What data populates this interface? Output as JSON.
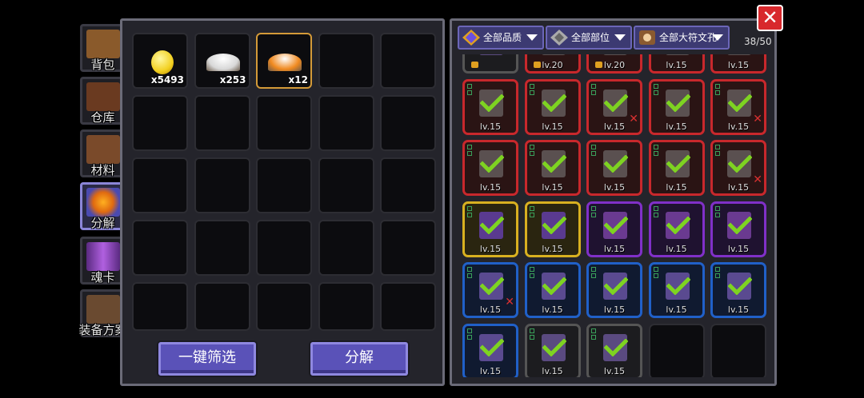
{
  "side_tabs": [
    {
      "label": "背包",
      "icon": "backpack-icon",
      "color": "#8a5a2b"
    },
    {
      "label": "仓库",
      "icon": "warehouse-chest-icon",
      "color": "#6a3a20"
    },
    {
      "label": "材料",
      "icon": "materials-book-icon",
      "color": "#7a4a2a"
    },
    {
      "label": "分解",
      "icon": "decompose-furnace-icon",
      "color": "#e06a10"
    },
    {
      "label": "魂卡",
      "icon": "soul-card-icon",
      "color": "#7a3aa0"
    },
    {
      "label": "装备方案",
      "icon": "equipment-plan-icon",
      "color": "#6a4a30"
    }
  ],
  "materials": [
    {
      "name": "gold-coin",
      "qty": "x5493",
      "color": "#f2d020"
    },
    {
      "name": "white-powder",
      "qty": "x253",
      "color": "#d8d8d8"
    },
    {
      "name": "orange-powder",
      "qty": "x12",
      "color": "#f08a20"
    }
  ],
  "left_buttons": {
    "quick_filter": "一键筛选",
    "decompose": "分解"
  },
  "filters": {
    "quality": "全部品质",
    "slot": "全部部位",
    "rune": "全部大符文孔"
  },
  "capacity": "38/50",
  "equipment": [
    {
      "q": "gray",
      "lvl": "",
      "lock": true
    },
    {
      "q": "red",
      "lvl": "lv.20",
      "lock": true
    },
    {
      "q": "red",
      "lvl": "lv.20",
      "lock": true
    },
    {
      "q": "red",
      "lvl": "lv.15",
      "lock": false
    },
    {
      "q": "red",
      "lvl": "lv.15",
      "lock": false
    },
    {
      "q": "red",
      "lvl": "lv.15",
      "check": true,
      "x": false
    },
    {
      "q": "red",
      "lvl": "lv.15",
      "check": true,
      "x": false
    },
    {
      "q": "red",
      "lvl": "lv.15",
      "check": true,
      "x": true
    },
    {
      "q": "red",
      "lvl": "lv.15",
      "check": true,
      "x": false
    },
    {
      "q": "red",
      "lvl": "lv.15",
      "check": true,
      "x": true
    },
    {
      "q": "red",
      "lvl": "lv.15",
      "check": true,
      "x": false
    },
    {
      "q": "red",
      "lvl": "lv.15",
      "check": true,
      "x": false
    },
    {
      "q": "red",
      "lvl": "lv.15",
      "check": true,
      "x": false
    },
    {
      "q": "red",
      "lvl": "lv.15",
      "check": true,
      "x": false
    },
    {
      "q": "red",
      "lvl": "lv.15",
      "check": true,
      "x": true
    },
    {
      "q": "yellow",
      "lvl": "lv.15",
      "check": true,
      "x": false
    },
    {
      "q": "yellow",
      "lvl": "lv.15",
      "check": true,
      "x": false
    },
    {
      "q": "purple",
      "lvl": "lv.15",
      "check": true,
      "x": false
    },
    {
      "q": "purple",
      "lvl": "lv.15",
      "check": true,
      "x": false
    },
    {
      "q": "purple",
      "lvl": "lv.15",
      "check": true,
      "x": false
    },
    {
      "q": "blue",
      "lvl": "lv.15",
      "check": true,
      "x": true
    },
    {
      "q": "blue",
      "lvl": "lv.15",
      "check": true,
      "x": false
    },
    {
      "q": "blue",
      "lvl": "lv.15",
      "check": true,
      "x": false
    },
    {
      "q": "blue",
      "lvl": "lv.15",
      "check": true,
      "x": false
    },
    {
      "q": "blue",
      "lvl": "lv.15",
      "check": true,
      "x": false
    },
    {
      "q": "blue",
      "lvl": "lv.15",
      "check": true,
      "x": false
    },
    {
      "q": "gray",
      "lvl": "lv.15",
      "check": true,
      "x": false
    },
    {
      "q": "gray",
      "lvl": "lv.15",
      "check": true,
      "x": false
    },
    {
      "q": "empty",
      "lvl": ""
    },
    {
      "q": "empty",
      "lvl": ""
    }
  ],
  "colors": {
    "accent": "#5a52b8",
    "close": "#d8282c",
    "selected": "#d49a38"
  }
}
